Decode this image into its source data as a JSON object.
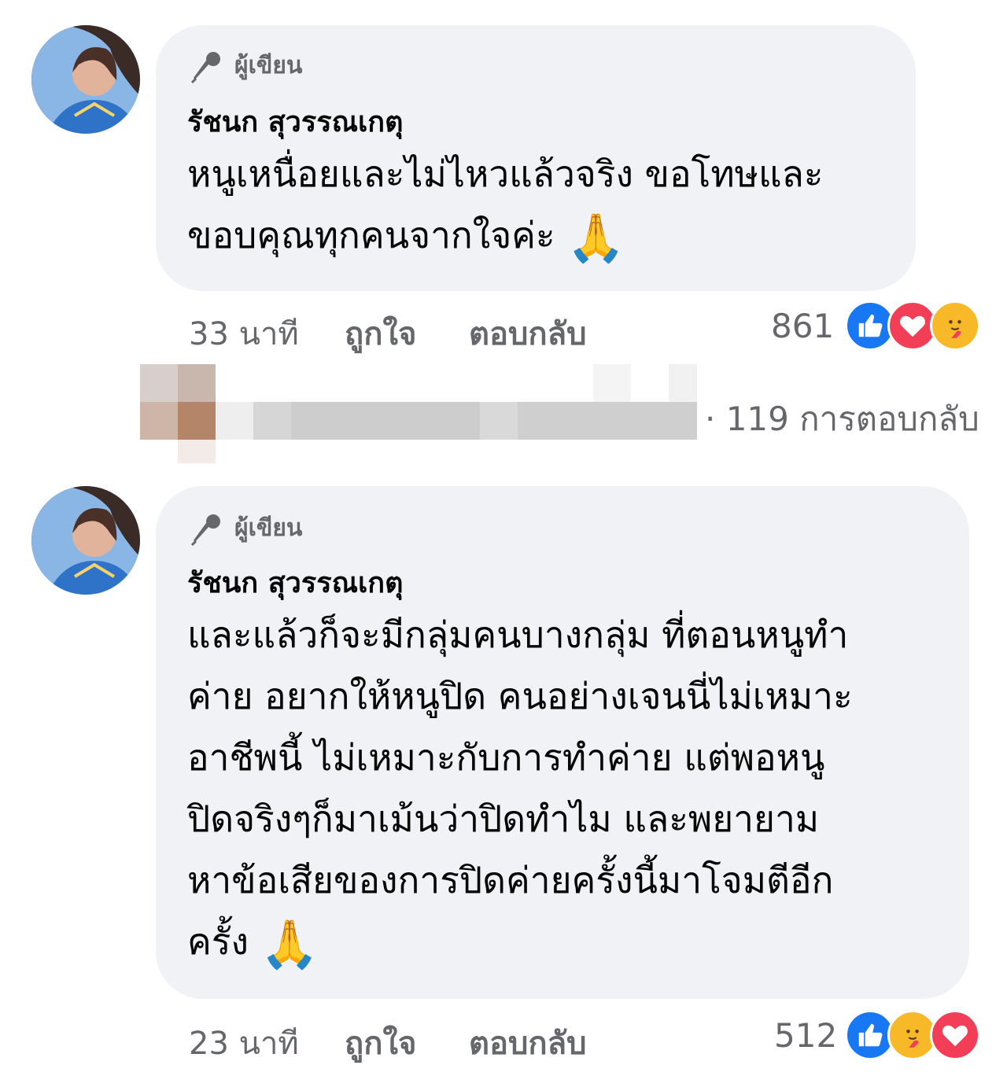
{
  "comments": [
    {
      "author_tag": "ผู้เขียน",
      "author_name": "รัชนก สุวรรณเกตุ",
      "lines": [
        "หนูเหนื่อยและไม่ไหวแล้วจริง ขอโทษและ",
        "ขอบคุณทุกคนจากใจค่ะ"
      ],
      "emoji": "🙏",
      "time": "33 นาที",
      "like_label": "ถูกใจ",
      "reply_label": "ตอบกลับ",
      "reaction_count": "861",
      "reactions": [
        "like-icon",
        "love-icon",
        "care-icon"
      ]
    },
    {
      "author_tag": "ผู้เขียน",
      "author_name": "รัชนก สุวรรณเกตุ",
      "lines": [
        "และแล้วก็จะมีกลุ่มคนบางกลุ่ม ที่ตอนหนูทำ",
        "ค่าย อยากให้หนูปิด คนอย่างเจนนี่ไม่เหมาะ",
        "อาชีพนี้ ไม่เหมาะกับการทำค่าย แต่พอหนู",
        "ปิดจริงๆก็มาเม้นว่าปิดทำไม และพยายาม",
        "หาข้อเสียของการปิดค่ายครั้งนี้มาโจมตีอีก",
        "ครั้ง"
      ],
      "emoji": "🙏",
      "time": "23 นาที",
      "like_label": "ถูกใจ",
      "reply_label": "ตอบกลับ",
      "reaction_count": "512",
      "reactions": [
        "like-icon",
        "care-icon",
        "love-icon"
      ]
    }
  ],
  "replies_summary": "· 119 การตอบกลับ",
  "colors": {
    "bubble": "#f0f2f5",
    "meta": "#65676b",
    "like": "#1877f2",
    "love": "#f33e58",
    "care": "#f7b928"
  }
}
